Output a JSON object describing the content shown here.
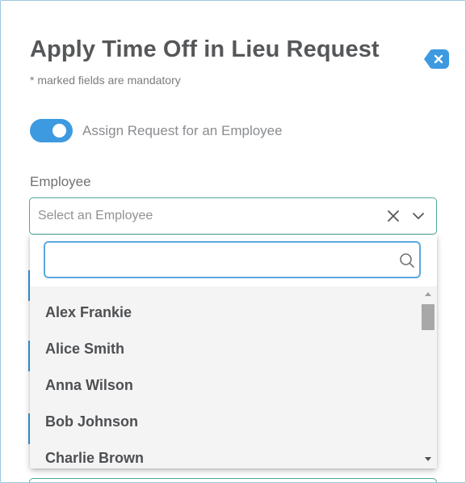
{
  "form": {
    "title": "Apply Time Off in Lieu Request",
    "mandatory_note": "* marked fields are mandatory",
    "close_icon": "close-icon"
  },
  "assign_toggle": {
    "label": "Assign Request for an Employee",
    "checked": true,
    "color": "#3d9ae0"
  },
  "employee_field": {
    "label": "Employee",
    "placeholder": "Select an Employee",
    "value": ""
  },
  "dropdown": {
    "search_value": "",
    "options": [
      "Alex Frankie",
      "Alice Smith",
      "Anna Wilson",
      "Bob Johnson",
      "Charlie Brown"
    ]
  },
  "colors": {
    "accent": "#3d9ae0",
    "field_border": "#4ea89c",
    "title_text": "#555759"
  }
}
